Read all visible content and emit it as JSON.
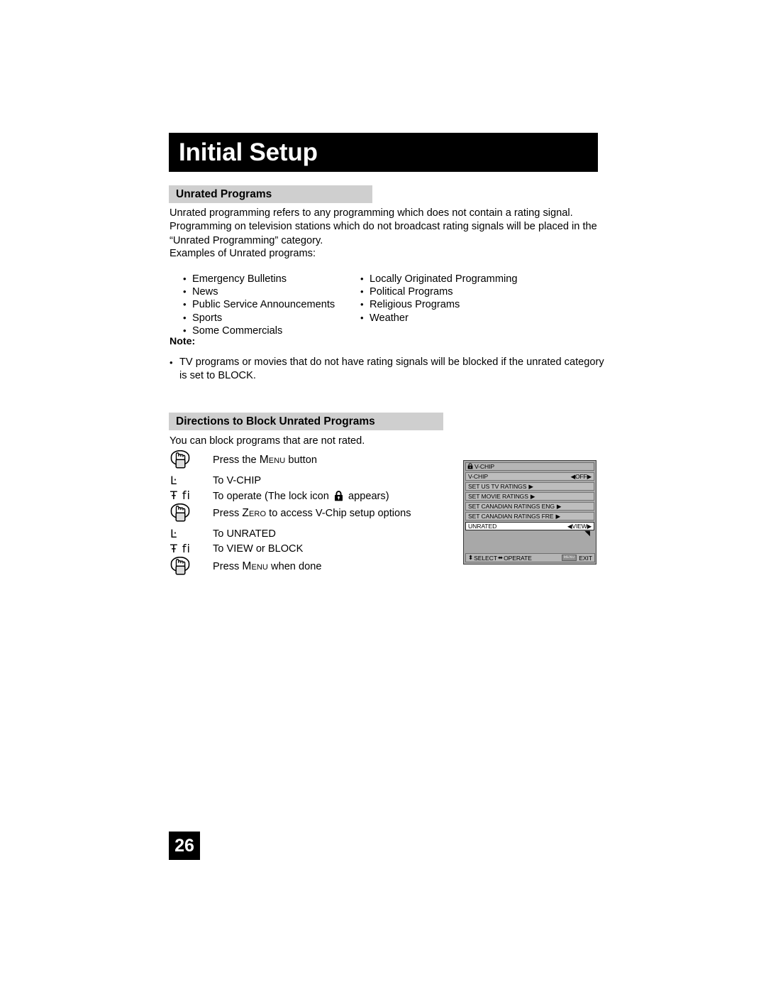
{
  "document": {
    "chapter_title": "Initial Setup",
    "page_number": "26"
  },
  "sections": {
    "unrated": {
      "heading": "Unrated Programs",
      "intro": "Unrated programming refers to any programming which does not contain a rating signal. Programming on television stations which do not broadcast rating signals will be placed in the “Unrated Programming” category.",
      "examples_label": "Examples of Unrated programs:",
      "examples_left": [
        "Emergency Bulletins",
        "News",
        "Public Service Announcements",
        "Sports",
        "Some Commercials"
      ],
      "examples_right": [
        "Locally Originated Programming",
        "Political Programs",
        "Religious Programs",
        "Weather"
      ],
      "note_label": "Note:",
      "note_text": "TV programs or movies that do not have rating signals will be blocked if the unrated category is set to BLOCK."
    },
    "directions": {
      "heading": "Directions to Block Unrated Programs",
      "intro": "You can block programs that are not rated.",
      "steps": [
        {
          "icon": "hand-press-icon",
          "glyph": "",
          "text_before": "Press the ",
          "key": "Menu",
          "text_after": " button"
        },
        {
          "icon": "broken-glyph",
          "glyph": "Ŀ",
          "text_before": "To V-CHIP",
          "key": "",
          "text_after": ""
        },
        {
          "icon": "broken-glyph",
          "glyph": "Ŧ fi",
          "text_before": "To operate (The lock icon ",
          "key": "",
          "text_after": " appears)",
          "has_lock": true
        },
        {
          "icon": "hand-press-icon",
          "glyph": "",
          "text_before": "Press ",
          "key": "Zero",
          "text_after": " to access V-Chip setup options"
        },
        {
          "icon": "broken-glyph",
          "glyph": "Ŀ",
          "text_before": "To UNRATED",
          "key": "",
          "text_after": ""
        },
        {
          "icon": "broken-glyph",
          "glyph": "Ŧ fi",
          "text_before": "To VIEW or BLOCK",
          "key": "",
          "text_after": ""
        },
        {
          "icon": "hand-press-icon",
          "glyph": "",
          "text_before": "Press ",
          "key": "Menu",
          "text_after": " when done"
        }
      ]
    }
  },
  "vchip_menu": {
    "title": "V-CHIP",
    "rows": [
      {
        "label": "V-CHIP",
        "value": "OFF",
        "value_style": "lr-arrows",
        "selected": false
      },
      {
        "label": "SET US TV RATINGS",
        "value": "",
        "value_style": "right-arrow",
        "selected": false
      },
      {
        "label": "SET MOVIE RATINGS",
        "value": "",
        "value_style": "right-arrow",
        "selected": false
      },
      {
        "label": "SET CANADIAN RATINGS ENG",
        "value": "",
        "value_style": "right-arrow",
        "selected": false
      },
      {
        "label": "SET CANADIAN RATINGS FRE",
        "value": "",
        "value_style": "right-arrow",
        "selected": false
      },
      {
        "label": "UNRATED",
        "value": "VIEW",
        "value_style": "lr-arrows",
        "selected": true
      }
    ],
    "footer": {
      "select_label": "SELECT",
      "operate_label": "OPERATE",
      "menu_key_label": "MENU",
      "exit_label": "EXIT"
    }
  },
  "colors": {
    "title_bar_bg": "#000000",
    "section_head_bg": "#cfcfcf",
    "menu_bg": "#a8a8a8",
    "menu_row_bg": "#bdbdbd",
    "menu_selected_bg": "#ffffff",
    "page_num_bg": "#000000"
  }
}
